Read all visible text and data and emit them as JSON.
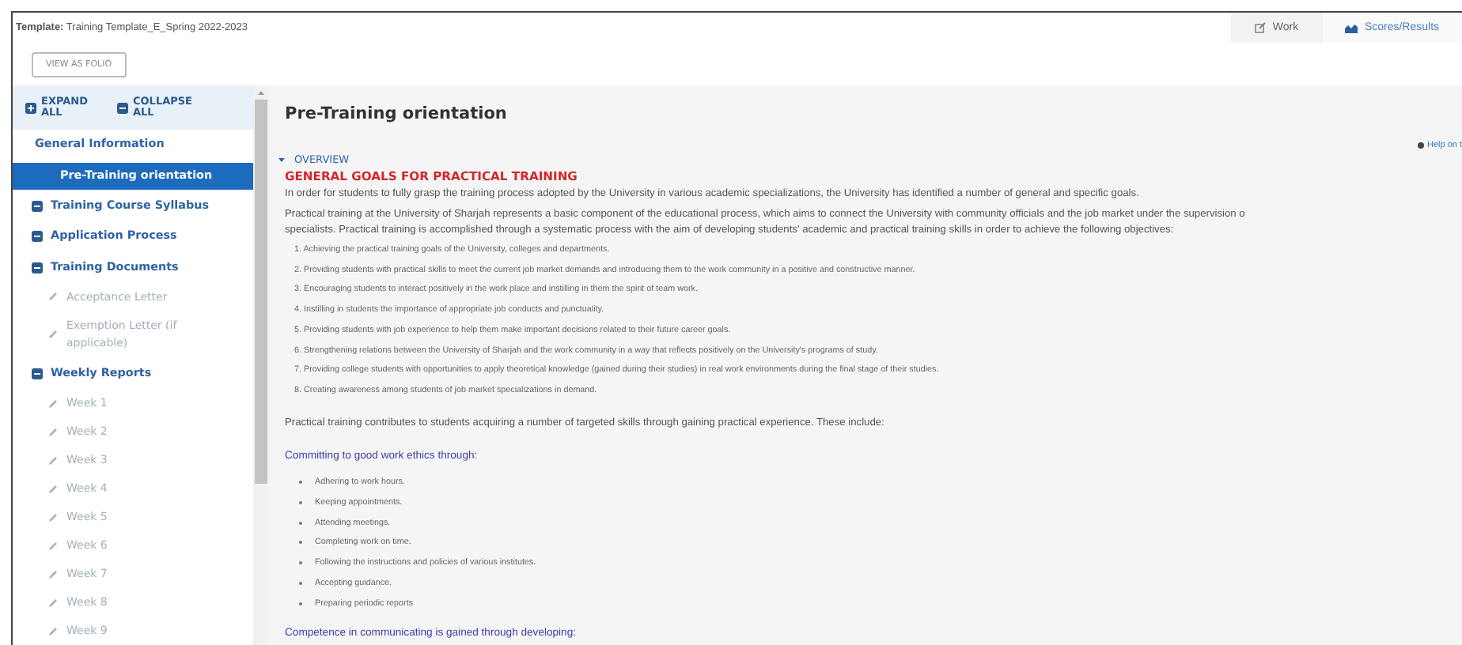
{
  "header": {
    "template_label": "Template:",
    "template_name": "Training Template_E_Spring 2022-2023"
  },
  "tabs": [
    {
      "label": "Work",
      "kind": "work",
      "selected": true
    },
    {
      "label": "Scores/Results",
      "kind": "scores",
      "selected": false
    }
  ],
  "folio_button": "VIEW AS FOLIO",
  "sidebar": {
    "expand_all": "EXPAND ALL",
    "collapse_all": "COLLAPSE ALL",
    "items": [
      {
        "label": "General Information",
        "kind": "heading",
        "selected": false,
        "children": [
          {
            "label": "Pre-Training orientation",
            "kind": "page",
            "selected": true
          }
        ]
      },
      {
        "label": "Training Course Syllabus",
        "kind": "section",
        "selected": false
      },
      {
        "label": "Application Process",
        "kind": "section",
        "selected": false
      },
      {
        "label": "Training Documents",
        "kind": "section",
        "selected": false,
        "children": [
          {
            "label": "Acceptance Letter",
            "kind": "task",
            "selected": false
          },
          {
            "label": "Exemption Letter (if applicable)",
            "kind": "task",
            "selected": false
          }
        ]
      },
      {
        "label": "Weekly Reports",
        "kind": "section",
        "selected": false,
        "children": [
          {
            "label": "Week 1",
            "kind": "task",
            "selected": false
          },
          {
            "label": "Week 2",
            "kind": "task",
            "selected": false
          },
          {
            "label": "Week 3",
            "kind": "task",
            "selected": false
          },
          {
            "label": "Week 4",
            "kind": "task",
            "selected": false
          },
          {
            "label": "Week 5",
            "kind": "task",
            "selected": false
          },
          {
            "label": "Week 6",
            "kind": "task",
            "selected": false
          },
          {
            "label": "Week 7",
            "kind": "task",
            "selected": false
          },
          {
            "label": "Week 8",
            "kind": "task",
            "selected": false
          },
          {
            "label": "Week 9",
            "kind": "task",
            "selected": false
          }
        ]
      }
    ]
  },
  "content": {
    "title": "Pre-Training orientation",
    "help_link": "Help on t",
    "overview": {
      "label": "OVERVIEW",
      "expanded": true
    },
    "heading": "GENERAL GOALS FOR PRACTICAL TRAINING",
    "intro": "In order for students to fully grasp the training process adopted by the University in various academic specializations, the University has identified a number of general and specific goals.",
    "paragraph_lines": [
      "Practical training at the University of Sharjah represents a basic component of the educational process, which aims to connect the University with community officials and the job market under the supervision o",
      "specialists. Practical training is accomplished through a systematic process with the aim of developing students' academic and practical training skills in order to achieve the following objectives:"
    ],
    "objectives": [
      "1. Achieving the practical training goals of the University, colleges and departments.",
      "2. Providing students with practical skills to meet the current job market demands and introducing them to the work community in a positive and constructive manner.",
      "3. Encouraging students to interact positively in the work place and instilling in them the spirit of team work.",
      "4. Instilling in students the importance of appropriate job conducts and punctuality.",
      "5. Providing students with job experience to help them make important decisions related to their future career goals.",
      "6. Strengthening relations between the University of Sharjah and the work community in a way that reflects positively on the University's programs of study.",
      "7. Providing college students with opportunities to apply theoretical knowledge (gained during their studies) in real work environments during the final stage of their studies.",
      "8. Creating awareness among students of job market specializations in demand."
    ],
    "summary": "Practical training contributes to students acquiring a number of targeted skills through gaining practical experience. These include:",
    "ethics_heading": "Committing to good work ethics through:",
    "ethics": [
      "Adhering to work hours.",
      "Keeping appointments.",
      "Attending meetings.",
      "Completing work on time.",
      "Following the instructions and policies of various institutes.",
      "Accepting guidance.",
      "Preparing periodic reports"
    ],
    "communication_heading": "Competence in communicating is gained through developing:"
  }
}
